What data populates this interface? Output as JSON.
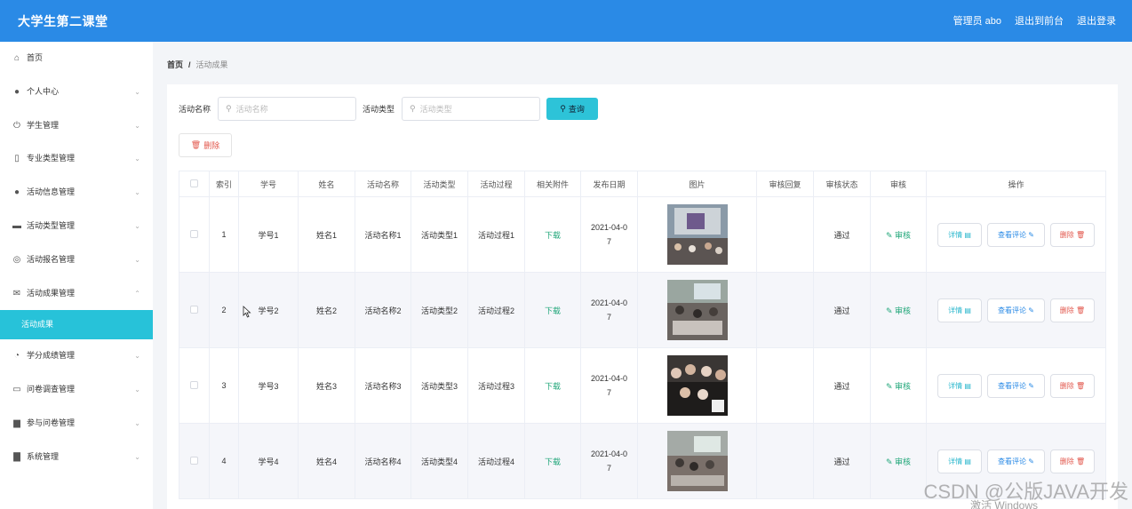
{
  "header": {
    "brand": "大学生第二课堂",
    "admin": "管理员 abo",
    "to_front": "退出到前台",
    "logout": "退出登录"
  },
  "sidebar": {
    "items": [
      {
        "label": "首页",
        "icon": "home-icon"
      },
      {
        "label": "个人中心",
        "icon": "user-icon"
      },
      {
        "label": "学生管理",
        "icon": "power-icon"
      },
      {
        "label": "专业类型管理",
        "icon": "mic-icon"
      },
      {
        "label": "活动信息管理",
        "icon": "pin-icon"
      },
      {
        "label": "活动类型管理",
        "icon": "comment-icon"
      },
      {
        "label": "活动报名管理",
        "icon": "globe-icon"
      },
      {
        "label": "活动成果管理",
        "icon": "mail-icon"
      },
      {
        "label": "学分成绩管理",
        "icon": "speed-icon"
      },
      {
        "label": "问卷调查管理",
        "icon": "chat-icon"
      },
      {
        "label": "参与问卷管理",
        "icon": "printer-icon"
      },
      {
        "label": "系统管理",
        "icon": "briefcase-icon"
      }
    ],
    "active_sub": "活动成果"
  },
  "breadcrumb": {
    "home": "首页",
    "sep": "/",
    "current": "活动成果"
  },
  "search": {
    "name_label": "活动名称",
    "name_placeholder": "活动名称",
    "type_label": "活动类型",
    "type_placeholder": "活动类型",
    "query": "查询"
  },
  "delete_label": "删除",
  "table": {
    "headers": [
      "索引",
      "学号",
      "姓名",
      "活动名称",
      "活动类型",
      "活动过程",
      "相关附件",
      "发布日期",
      "图片",
      "审核回复",
      "审核状态",
      "审核",
      "操作"
    ],
    "rows": [
      {
        "idx": "1",
        "sid": "学号1",
        "name": "姓名1",
        "act": "活动名称1",
        "type": "活动类型1",
        "proc": "活动过程1",
        "file": "下载",
        "date1": "2021-04-0",
        "date2": "7",
        "reply": "",
        "status": "通过",
        "audit": "审核"
      },
      {
        "idx": "2",
        "sid": "学号2",
        "name": "姓名2",
        "act": "活动名称2",
        "type": "活动类型2",
        "proc": "活动过程2",
        "file": "下载",
        "date1": "2021-04-0",
        "date2": "7",
        "reply": "",
        "status": "通过",
        "audit": "审核"
      },
      {
        "idx": "3",
        "sid": "学号3",
        "name": "姓名3",
        "act": "活动名称3",
        "type": "活动类型3",
        "proc": "活动过程3",
        "file": "下载",
        "date1": "2021-04-0",
        "date2": "7",
        "reply": "",
        "status": "通过",
        "audit": "审核"
      },
      {
        "idx": "4",
        "sid": "学号4",
        "name": "姓名4",
        "act": "活动名称4",
        "type": "活动类型4",
        "proc": "活动过程4",
        "file": "下载",
        "date1": "2021-04-0",
        "date2": "7",
        "reply": "",
        "status": "通过",
        "audit": "审核"
      }
    ],
    "ops": {
      "detail": "详情",
      "comments": "查看评论",
      "delete": "删除"
    }
  },
  "watermark": "CSDN @公版JAVA开发",
  "activate": "激活 Windows"
}
